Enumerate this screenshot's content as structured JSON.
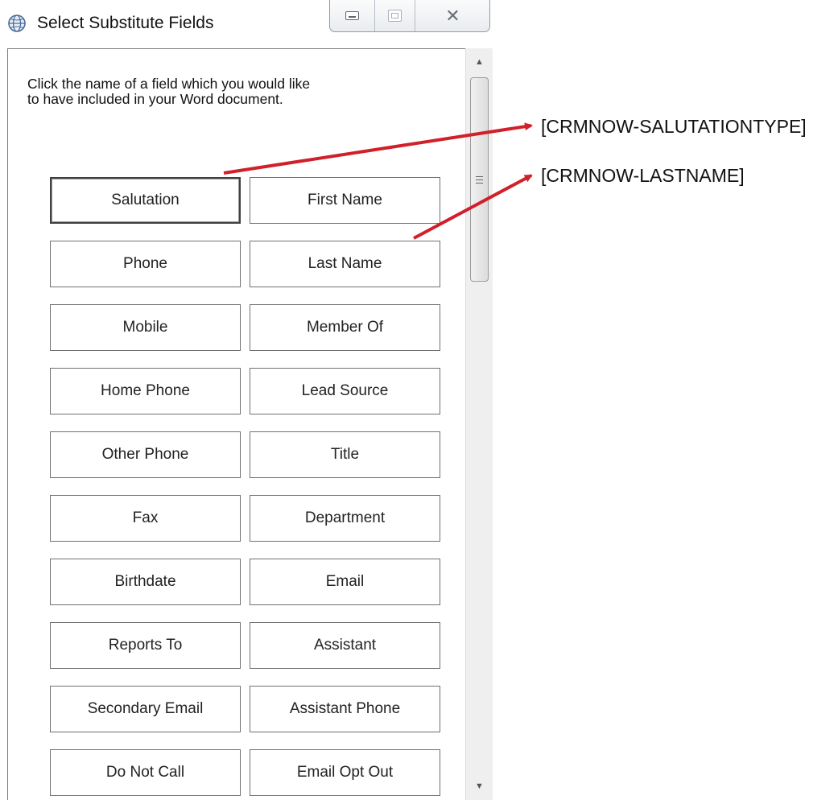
{
  "window": {
    "title": "Select Substitute Fields",
    "controls": {
      "minimize": "minimize",
      "maximize": "maximize",
      "close": "close"
    }
  },
  "instructions": "Click the name of a field which you would like to have included in your Word document.",
  "fields": [
    "Salutation",
    "First Name",
    "Phone",
    "Last Name",
    "Mobile",
    "Member Of",
    "Home Phone",
    "Lead Source",
    "Other Phone",
    "Title",
    "Fax",
    "Department",
    "Birthdate",
    "Email",
    "Reports To",
    "Assistant",
    "Secondary Email",
    "Assistant Phone",
    "Do Not Call",
    "Email Opt Out"
  ],
  "selected_field": "Salutation",
  "annotations": {
    "salutation": "[CRMNOW-SALUTATIONTYPE]",
    "lastname": "[CRMNOW-LASTNAME]",
    "arrow_color": "#d0202a"
  },
  "icons": {
    "app": "globe-icon",
    "scroll_up": "chevron-up-icon",
    "scroll_down": "chevron-down-icon",
    "scroll_grip": "grip-icon"
  }
}
